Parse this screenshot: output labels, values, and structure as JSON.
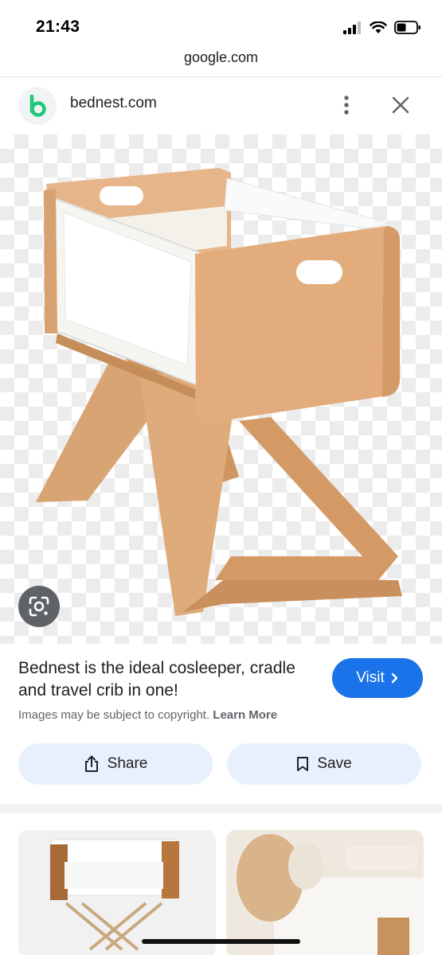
{
  "status_bar": {
    "time": "21:43"
  },
  "browser": {
    "url": "google.com"
  },
  "site": {
    "name": "bednest.com"
  },
  "result": {
    "title": "Bednest is the ideal cosleeper, cradle and travel crib in one!",
    "visit_label": "Visit",
    "copyright_text": "Images may be subject to copyright.",
    "learn_more_label": "Learn More"
  },
  "actions": {
    "share_label": "Share",
    "save_label": "Save"
  },
  "colors": {
    "accent": "#1a73e8",
    "logo_green": "#20c77a",
    "button_bg": "#e8f0fe"
  },
  "icons": [
    "signal-icon",
    "wifi-icon",
    "battery-icon",
    "bednest-logo-icon",
    "more-vert-icon",
    "close-icon",
    "google-lens-icon",
    "chevron-right-icon",
    "share-icon",
    "bookmark-icon"
  ]
}
